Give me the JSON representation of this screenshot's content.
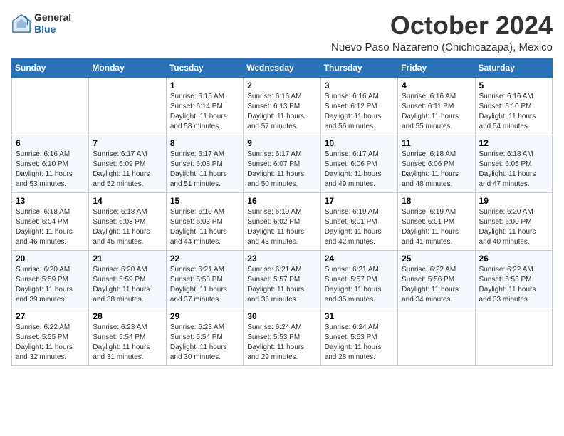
{
  "logo": {
    "general": "General",
    "blue": "Blue"
  },
  "header": {
    "month": "October 2024",
    "location": "Nuevo Paso Nazareno (Chichicazapa), Mexico"
  },
  "days_of_week": [
    "Sunday",
    "Monday",
    "Tuesday",
    "Wednesday",
    "Thursday",
    "Friday",
    "Saturday"
  ],
  "weeks": [
    [
      {
        "num": "",
        "info": ""
      },
      {
        "num": "",
        "info": ""
      },
      {
        "num": "1",
        "info": "Sunrise: 6:15 AM\nSunset: 6:14 PM\nDaylight: 11 hours and 58 minutes."
      },
      {
        "num": "2",
        "info": "Sunrise: 6:16 AM\nSunset: 6:13 PM\nDaylight: 11 hours and 57 minutes."
      },
      {
        "num": "3",
        "info": "Sunrise: 6:16 AM\nSunset: 6:12 PM\nDaylight: 11 hours and 56 minutes."
      },
      {
        "num": "4",
        "info": "Sunrise: 6:16 AM\nSunset: 6:11 PM\nDaylight: 11 hours and 55 minutes."
      },
      {
        "num": "5",
        "info": "Sunrise: 6:16 AM\nSunset: 6:10 PM\nDaylight: 11 hours and 54 minutes."
      }
    ],
    [
      {
        "num": "6",
        "info": "Sunrise: 6:16 AM\nSunset: 6:10 PM\nDaylight: 11 hours and 53 minutes."
      },
      {
        "num": "7",
        "info": "Sunrise: 6:17 AM\nSunset: 6:09 PM\nDaylight: 11 hours and 52 minutes."
      },
      {
        "num": "8",
        "info": "Sunrise: 6:17 AM\nSunset: 6:08 PM\nDaylight: 11 hours and 51 minutes."
      },
      {
        "num": "9",
        "info": "Sunrise: 6:17 AM\nSunset: 6:07 PM\nDaylight: 11 hours and 50 minutes."
      },
      {
        "num": "10",
        "info": "Sunrise: 6:17 AM\nSunset: 6:06 PM\nDaylight: 11 hours and 49 minutes."
      },
      {
        "num": "11",
        "info": "Sunrise: 6:18 AM\nSunset: 6:06 PM\nDaylight: 11 hours and 48 minutes."
      },
      {
        "num": "12",
        "info": "Sunrise: 6:18 AM\nSunset: 6:05 PM\nDaylight: 11 hours and 47 minutes."
      }
    ],
    [
      {
        "num": "13",
        "info": "Sunrise: 6:18 AM\nSunset: 6:04 PM\nDaylight: 11 hours and 46 minutes."
      },
      {
        "num": "14",
        "info": "Sunrise: 6:18 AM\nSunset: 6:03 PM\nDaylight: 11 hours and 45 minutes."
      },
      {
        "num": "15",
        "info": "Sunrise: 6:19 AM\nSunset: 6:03 PM\nDaylight: 11 hours and 44 minutes."
      },
      {
        "num": "16",
        "info": "Sunrise: 6:19 AM\nSunset: 6:02 PM\nDaylight: 11 hours and 43 minutes."
      },
      {
        "num": "17",
        "info": "Sunrise: 6:19 AM\nSunset: 6:01 PM\nDaylight: 11 hours and 42 minutes."
      },
      {
        "num": "18",
        "info": "Sunrise: 6:19 AM\nSunset: 6:01 PM\nDaylight: 11 hours and 41 minutes."
      },
      {
        "num": "19",
        "info": "Sunrise: 6:20 AM\nSunset: 6:00 PM\nDaylight: 11 hours and 40 minutes."
      }
    ],
    [
      {
        "num": "20",
        "info": "Sunrise: 6:20 AM\nSunset: 5:59 PM\nDaylight: 11 hours and 39 minutes."
      },
      {
        "num": "21",
        "info": "Sunrise: 6:20 AM\nSunset: 5:59 PM\nDaylight: 11 hours and 38 minutes."
      },
      {
        "num": "22",
        "info": "Sunrise: 6:21 AM\nSunset: 5:58 PM\nDaylight: 11 hours and 37 minutes."
      },
      {
        "num": "23",
        "info": "Sunrise: 6:21 AM\nSunset: 5:57 PM\nDaylight: 11 hours and 36 minutes."
      },
      {
        "num": "24",
        "info": "Sunrise: 6:21 AM\nSunset: 5:57 PM\nDaylight: 11 hours and 35 minutes."
      },
      {
        "num": "25",
        "info": "Sunrise: 6:22 AM\nSunset: 5:56 PM\nDaylight: 11 hours and 34 minutes."
      },
      {
        "num": "26",
        "info": "Sunrise: 6:22 AM\nSunset: 5:56 PM\nDaylight: 11 hours and 33 minutes."
      }
    ],
    [
      {
        "num": "27",
        "info": "Sunrise: 6:22 AM\nSunset: 5:55 PM\nDaylight: 11 hours and 32 minutes."
      },
      {
        "num": "28",
        "info": "Sunrise: 6:23 AM\nSunset: 5:54 PM\nDaylight: 11 hours and 31 minutes."
      },
      {
        "num": "29",
        "info": "Sunrise: 6:23 AM\nSunset: 5:54 PM\nDaylight: 11 hours and 30 minutes."
      },
      {
        "num": "30",
        "info": "Sunrise: 6:24 AM\nSunset: 5:53 PM\nDaylight: 11 hours and 29 minutes."
      },
      {
        "num": "31",
        "info": "Sunrise: 6:24 AM\nSunset: 5:53 PM\nDaylight: 11 hours and 28 minutes."
      },
      {
        "num": "",
        "info": ""
      },
      {
        "num": "",
        "info": ""
      }
    ]
  ]
}
